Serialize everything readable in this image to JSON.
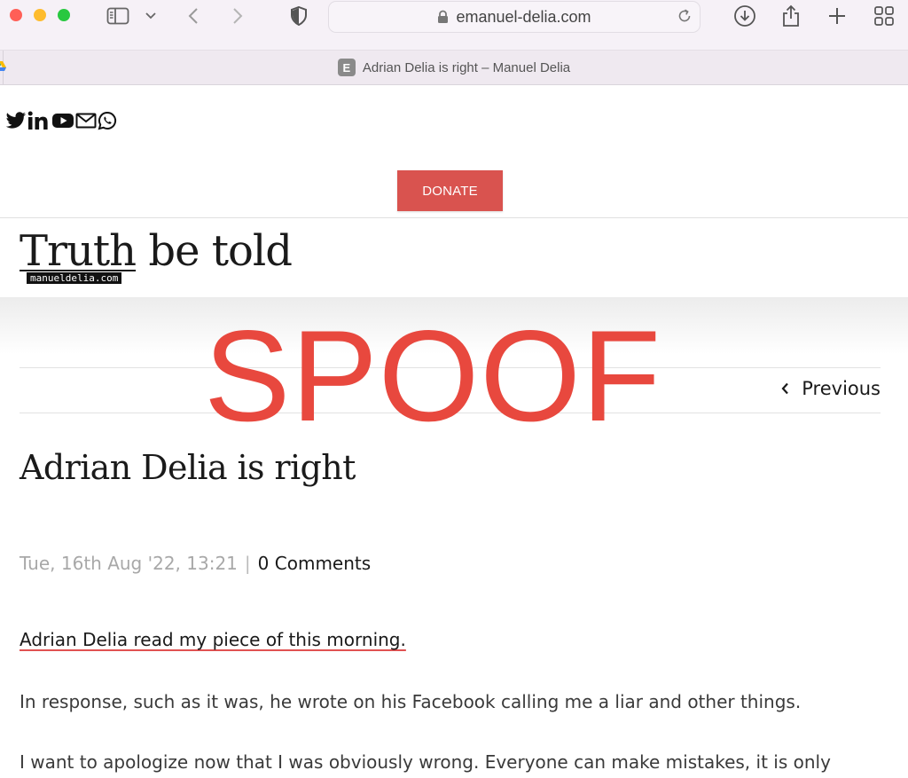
{
  "browser": {
    "url": "emanuel-delia.com",
    "tab_title": "Adrian Delia is right – Manuel Delia",
    "favicon_letter": "E",
    "traffic_lights": [
      "#ff5f57",
      "#febc2e",
      "#28c840"
    ],
    "icons": [
      "sidebar-icon",
      "chevron-down-icon",
      "back-icon",
      "forward-icon",
      "shield-icon",
      "lock-icon",
      "reload-icon",
      "download-icon",
      "share-icon",
      "new-tab-icon",
      "tab-overview-icon",
      "google-drive-icon"
    ]
  },
  "social": {
    "icons": [
      "twitter-icon",
      "linkedin-icon",
      "youtube-icon",
      "email-icon",
      "whatsapp-icon"
    ]
  },
  "header": {
    "donate_label": "DONATE",
    "donate_color": "#d9534f",
    "brand_title_part1": "Truth",
    "brand_title_part2": " be told",
    "brand_subtitle": "manueldelia.com"
  },
  "overlay": {
    "stamp_text": "SPOOF",
    "stamp_color": "#e8483e"
  },
  "post_nav": {
    "previous_label": "Previous"
  },
  "article": {
    "title": "Adrian Delia is right",
    "date": "Tue, 16th Aug '22, 13:21",
    "separator": "|",
    "comments": "0 Comments",
    "paragraphs": [
      "Adrian Delia read my piece of this morning.",
      "In response, such as it was, he wrote on his Facebook calling me a liar and other things.",
      "I want to apologize now that I was obviously wrong. Everyone can make mistakes, it is only"
    ]
  }
}
